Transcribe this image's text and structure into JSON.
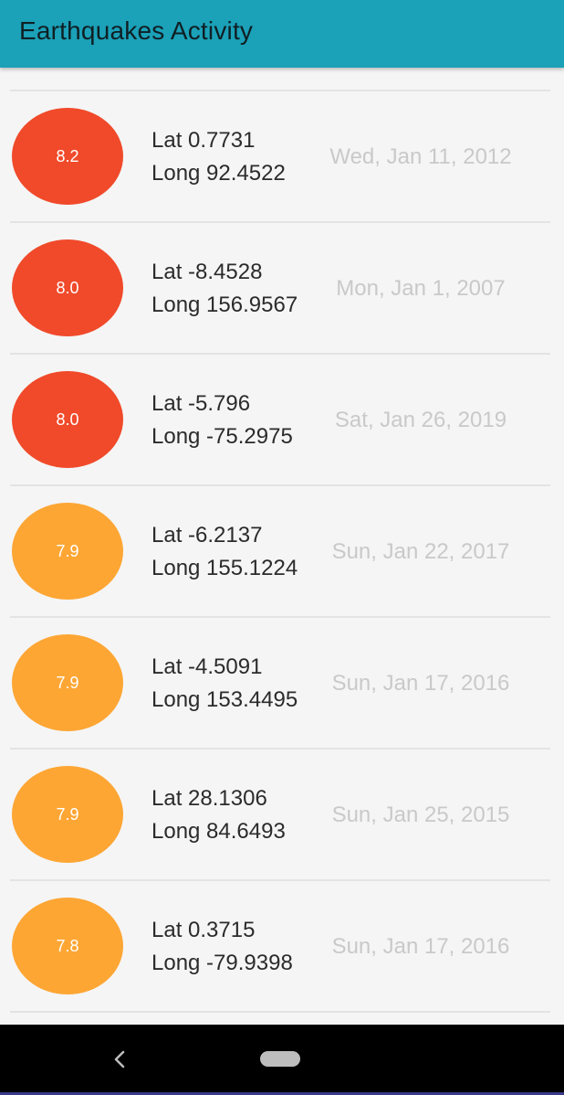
{
  "app_bar": {
    "title": "Earthquakes Activity",
    "color": "#1ba1b8"
  },
  "colors": {
    "high_magnitude": "#f04a2a",
    "medium_magnitude": "#fda634",
    "date_text": "#c9c9c9"
  },
  "earthquakes": [
    {
      "magnitude": "8.2",
      "lat": "Lat 0.7731",
      "long": "Long 92.4522",
      "date": "Wed, Jan 11, 2012",
      "color": "#f04a2a"
    },
    {
      "magnitude": "8.0",
      "lat": "Lat -8.4528",
      "long": "Long 156.9567",
      "date": "Mon, Jan 1, 2007",
      "color": "#f04a2a"
    },
    {
      "magnitude": "8.0",
      "lat": "Lat -5.796",
      "long": "Long -75.2975",
      "date": "Sat, Jan 26, 2019",
      "color": "#f04a2a"
    },
    {
      "magnitude": "7.9",
      "lat": "Lat -6.2137",
      "long": "Long 155.1224",
      "date": "Sun, Jan 22, 2017",
      "color": "#fda634"
    },
    {
      "magnitude": "7.9",
      "lat": "Lat -4.5091",
      "long": "Long 153.4495",
      "date": "Sun, Jan 17, 2016",
      "color": "#fda634"
    },
    {
      "magnitude": "7.9",
      "lat": "Lat 28.1306",
      "long": "Long 84.6493",
      "date": "Sun, Jan 25, 2015",
      "color": "#fda634"
    },
    {
      "magnitude": "7.8",
      "lat": "Lat 0.3715",
      "long": "Long -79.9398",
      "date": "Sun, Jan 17, 2016",
      "color": "#fda634"
    }
  ],
  "nav_bar": {
    "back_icon": "chevron-left-icon",
    "home_icon": "home-pill-icon"
  }
}
